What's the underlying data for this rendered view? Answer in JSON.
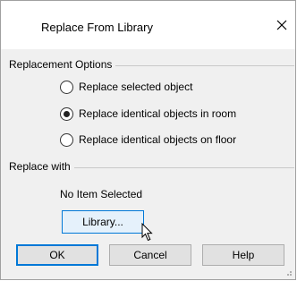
{
  "dialog": {
    "title": "Replace From Library",
    "close_icon": "close-icon"
  },
  "replacement_options": {
    "label": "Replacement Options",
    "options": [
      {
        "label": "Replace selected object",
        "selected": false
      },
      {
        "label": "Replace identical objects in room",
        "selected": true
      },
      {
        "label": "Replace identical objects on floor",
        "selected": false
      }
    ]
  },
  "replace_with": {
    "label": "Replace with",
    "status": "No Item Selected",
    "library_label": "Library..."
  },
  "buttons": {
    "ok": "OK",
    "cancel": "Cancel",
    "help": "Help"
  },
  "colors": {
    "accent": "#0078d7",
    "dialog_bg": "#f0f0f0",
    "titlebar_bg": "#ffffff"
  }
}
